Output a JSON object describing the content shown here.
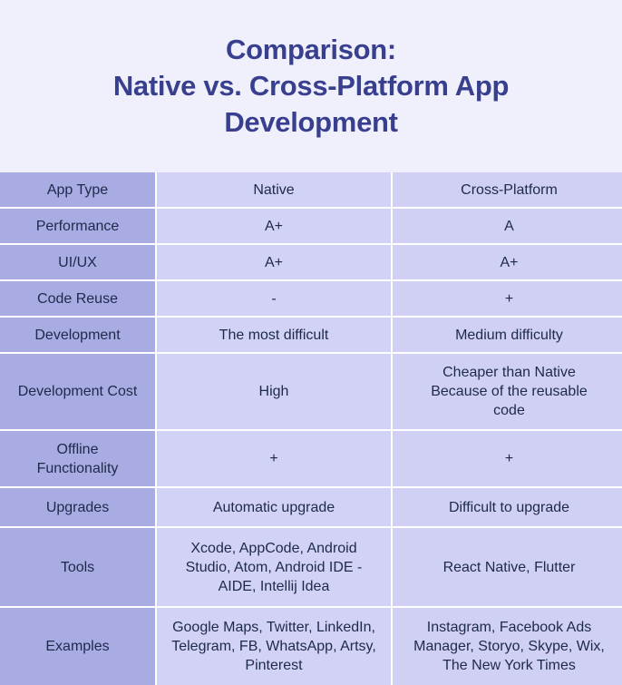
{
  "header": {
    "title_lines": [
      "Comparison:",
      "Native vs. Cross-Platform App",
      "Development"
    ]
  },
  "colors": {
    "title": "#383f8e",
    "label_bg": "#a9abe3",
    "value_bg": "#d1d2f5",
    "text": "#1e2a4a",
    "page_bg": "#f0f0fc"
  },
  "table": {
    "rows": [
      {
        "label": "App Type",
        "native": "Native",
        "cross": "Cross-Platform"
      },
      {
        "label": "Performance",
        "native": "A+",
        "cross": "A"
      },
      {
        "label": "UI/UX",
        "native": "A+",
        "cross": "A+"
      },
      {
        "label": "Code Reuse",
        "native": "-",
        "cross": "+"
      },
      {
        "label": "Development",
        "native": "The most difficult",
        "cross": "Medium difficulty"
      },
      {
        "label": "Development Cost",
        "native": "High",
        "cross": "Cheaper than Native Because of the reusable code"
      },
      {
        "label": "Offline Functionality",
        "native": "+",
        "cross": "+"
      },
      {
        "label": "Upgrades",
        "native": "Automatic upgrade",
        "cross": "Difficult to upgrade"
      },
      {
        "label": "Tools",
        "native": "Xcode, AppCode, Android Studio, Atom, Android IDE - AIDE, Intellij Idea",
        "cross": "React Native, Flutter"
      },
      {
        "label": "Examples",
        "native": "Google Maps, Twitter, LinkedIn, Telegram, FB, WhatsApp, Artsy, Pinterest",
        "cross": "Instagram, Facebook Ads Manager, Storyo, Skype, Wix, The New York Times"
      }
    ]
  }
}
